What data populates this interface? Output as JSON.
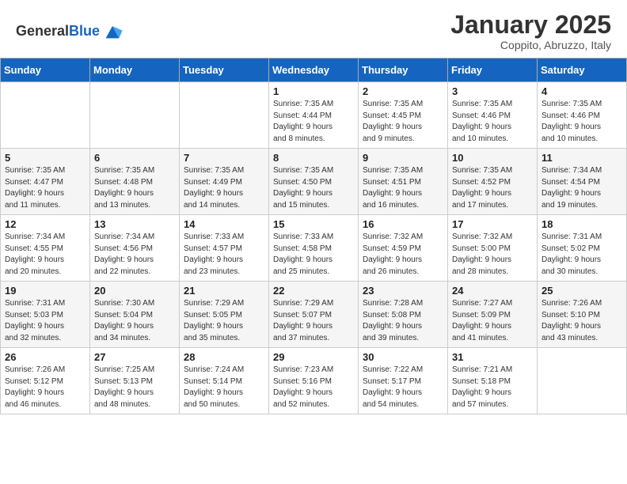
{
  "header": {
    "logo_general": "General",
    "logo_blue": "Blue",
    "month": "January 2025",
    "location": "Coppito, Abruzzo, Italy"
  },
  "weekdays": [
    "Sunday",
    "Monday",
    "Tuesday",
    "Wednesday",
    "Thursday",
    "Friday",
    "Saturday"
  ],
  "weeks": [
    [
      {
        "day": "",
        "info": ""
      },
      {
        "day": "",
        "info": ""
      },
      {
        "day": "",
        "info": ""
      },
      {
        "day": "1",
        "info": "Sunrise: 7:35 AM\nSunset: 4:44 PM\nDaylight: 9 hours\nand 8 minutes."
      },
      {
        "day": "2",
        "info": "Sunrise: 7:35 AM\nSunset: 4:45 PM\nDaylight: 9 hours\nand 9 minutes."
      },
      {
        "day": "3",
        "info": "Sunrise: 7:35 AM\nSunset: 4:46 PM\nDaylight: 9 hours\nand 10 minutes."
      },
      {
        "day": "4",
        "info": "Sunrise: 7:35 AM\nSunset: 4:46 PM\nDaylight: 9 hours\nand 10 minutes."
      }
    ],
    [
      {
        "day": "5",
        "info": "Sunrise: 7:35 AM\nSunset: 4:47 PM\nDaylight: 9 hours\nand 11 minutes."
      },
      {
        "day": "6",
        "info": "Sunrise: 7:35 AM\nSunset: 4:48 PM\nDaylight: 9 hours\nand 13 minutes."
      },
      {
        "day": "7",
        "info": "Sunrise: 7:35 AM\nSunset: 4:49 PM\nDaylight: 9 hours\nand 14 minutes."
      },
      {
        "day": "8",
        "info": "Sunrise: 7:35 AM\nSunset: 4:50 PM\nDaylight: 9 hours\nand 15 minutes."
      },
      {
        "day": "9",
        "info": "Sunrise: 7:35 AM\nSunset: 4:51 PM\nDaylight: 9 hours\nand 16 minutes."
      },
      {
        "day": "10",
        "info": "Sunrise: 7:35 AM\nSunset: 4:52 PM\nDaylight: 9 hours\nand 17 minutes."
      },
      {
        "day": "11",
        "info": "Sunrise: 7:34 AM\nSunset: 4:54 PM\nDaylight: 9 hours\nand 19 minutes."
      }
    ],
    [
      {
        "day": "12",
        "info": "Sunrise: 7:34 AM\nSunset: 4:55 PM\nDaylight: 9 hours\nand 20 minutes."
      },
      {
        "day": "13",
        "info": "Sunrise: 7:34 AM\nSunset: 4:56 PM\nDaylight: 9 hours\nand 22 minutes."
      },
      {
        "day": "14",
        "info": "Sunrise: 7:33 AM\nSunset: 4:57 PM\nDaylight: 9 hours\nand 23 minutes."
      },
      {
        "day": "15",
        "info": "Sunrise: 7:33 AM\nSunset: 4:58 PM\nDaylight: 9 hours\nand 25 minutes."
      },
      {
        "day": "16",
        "info": "Sunrise: 7:32 AM\nSunset: 4:59 PM\nDaylight: 9 hours\nand 26 minutes."
      },
      {
        "day": "17",
        "info": "Sunrise: 7:32 AM\nSunset: 5:00 PM\nDaylight: 9 hours\nand 28 minutes."
      },
      {
        "day": "18",
        "info": "Sunrise: 7:31 AM\nSunset: 5:02 PM\nDaylight: 9 hours\nand 30 minutes."
      }
    ],
    [
      {
        "day": "19",
        "info": "Sunrise: 7:31 AM\nSunset: 5:03 PM\nDaylight: 9 hours\nand 32 minutes."
      },
      {
        "day": "20",
        "info": "Sunrise: 7:30 AM\nSunset: 5:04 PM\nDaylight: 9 hours\nand 34 minutes."
      },
      {
        "day": "21",
        "info": "Sunrise: 7:29 AM\nSunset: 5:05 PM\nDaylight: 9 hours\nand 35 minutes."
      },
      {
        "day": "22",
        "info": "Sunrise: 7:29 AM\nSunset: 5:07 PM\nDaylight: 9 hours\nand 37 minutes."
      },
      {
        "day": "23",
        "info": "Sunrise: 7:28 AM\nSunset: 5:08 PM\nDaylight: 9 hours\nand 39 minutes."
      },
      {
        "day": "24",
        "info": "Sunrise: 7:27 AM\nSunset: 5:09 PM\nDaylight: 9 hours\nand 41 minutes."
      },
      {
        "day": "25",
        "info": "Sunrise: 7:26 AM\nSunset: 5:10 PM\nDaylight: 9 hours\nand 43 minutes."
      }
    ],
    [
      {
        "day": "26",
        "info": "Sunrise: 7:26 AM\nSunset: 5:12 PM\nDaylight: 9 hours\nand 46 minutes."
      },
      {
        "day": "27",
        "info": "Sunrise: 7:25 AM\nSunset: 5:13 PM\nDaylight: 9 hours\nand 48 minutes."
      },
      {
        "day": "28",
        "info": "Sunrise: 7:24 AM\nSunset: 5:14 PM\nDaylight: 9 hours\nand 50 minutes."
      },
      {
        "day": "29",
        "info": "Sunrise: 7:23 AM\nSunset: 5:16 PM\nDaylight: 9 hours\nand 52 minutes."
      },
      {
        "day": "30",
        "info": "Sunrise: 7:22 AM\nSunset: 5:17 PM\nDaylight: 9 hours\nand 54 minutes."
      },
      {
        "day": "31",
        "info": "Sunrise: 7:21 AM\nSunset: 5:18 PM\nDaylight: 9 hours\nand 57 minutes."
      },
      {
        "day": "",
        "info": ""
      }
    ]
  ]
}
